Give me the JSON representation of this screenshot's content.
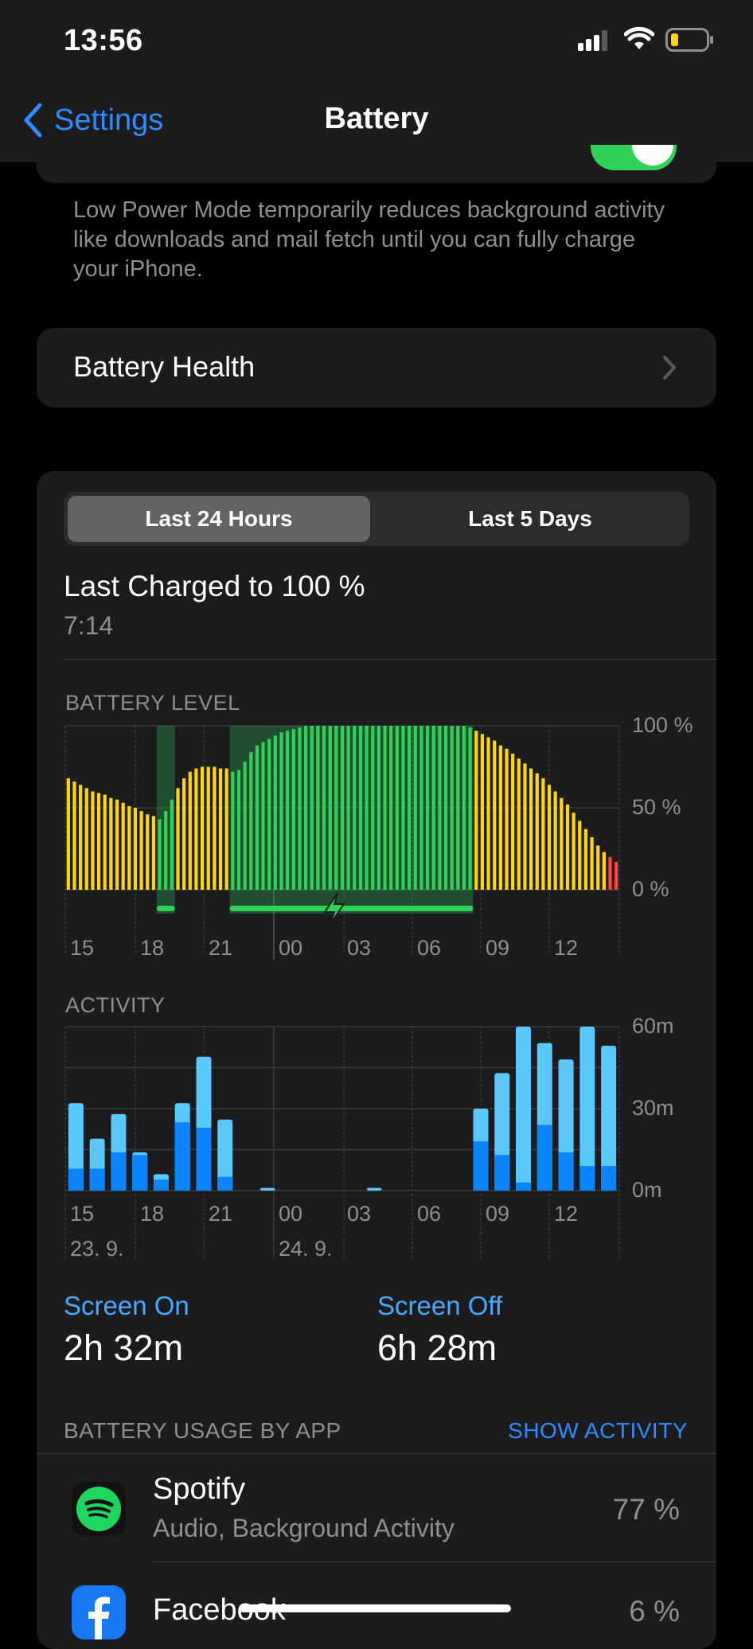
{
  "status": {
    "time": "13:56"
  },
  "nav": {
    "back_label": "Settings",
    "title": "Battery"
  },
  "low_power": {
    "description": "Low Power Mode temporarily reduces background activity like downloads and mail fetch until you can fully charge your iPhone.",
    "toggle_on": true
  },
  "battery_health": {
    "label": "Battery Health"
  },
  "segments": {
    "options": [
      "Last 24 Hours",
      "Last 5 Days"
    ],
    "selected": "Last 24 Hours"
  },
  "last_charged": {
    "title": "Last Charged to 100 %",
    "time": "7:14"
  },
  "battery_level": {
    "label": "BATTERY LEVEL",
    "y_ticks": [
      "100 %",
      "50 %",
      "0 %"
    ],
    "x_ticks": [
      "15",
      "18",
      "21",
      "00",
      "03",
      "06",
      "09",
      "12"
    ]
  },
  "activity": {
    "label": "ACTIVITY",
    "y_ticks": [
      "60m",
      "30m",
      "0m"
    ],
    "x_ticks": [
      "15",
      "18",
      "21",
      "00",
      "03",
      "06",
      "09",
      "12"
    ],
    "date_labels": [
      "23. 9.",
      "24. 9."
    ]
  },
  "screen_on": {
    "label": "Screen On",
    "value": "2h 32m"
  },
  "screen_off": {
    "label": "Screen Off",
    "value": "6h 28m"
  },
  "usage": {
    "label": "BATTERY USAGE BY APP",
    "show_activity": "SHOW ACTIVITY",
    "apps": [
      {
        "name": "Spotify",
        "detail": "Audio, Background Activity",
        "percent": "77 %",
        "icon": "spotify-icon"
      },
      {
        "name": "Facebook",
        "detail": "",
        "percent": "6 %",
        "icon": "facebook-icon"
      }
    ]
  },
  "chart_data": [
    {
      "type": "bar",
      "title": "BATTERY LEVEL",
      "x_ticks": [
        "15",
        "18",
        "21",
        "00",
        "03",
        "06",
        "09",
        "12"
      ],
      "ylim": [
        0,
        100
      ],
      "y_ticks": [
        "0 %",
        "50 %",
        "100 %"
      ],
      "unit": "%",
      "values": [
        68,
        66,
        64,
        62,
        60,
        59,
        58,
        56,
        55,
        53,
        51,
        50,
        48,
        46,
        45,
        43,
        48,
        55,
        62,
        68,
        72,
        74,
        75,
        75,
        75,
        74,
        74,
        72,
        73,
        78,
        84,
        88,
        90,
        92,
        94,
        96,
        97,
        98,
        99,
        100,
        100,
        100,
        100,
        100,
        100,
        100,
        100,
        100,
        100,
        100,
        100,
        100,
        100,
        100,
        100,
        100,
        100,
        100,
        100,
        100,
        100,
        100,
        100,
        100,
        100,
        100,
        99,
        97,
        95,
        93,
        91,
        88,
        86,
        83,
        80,
        77,
        74,
        71,
        68,
        64,
        60,
        56,
        52,
        47,
        42,
        37,
        32,
        27,
        23,
        20,
        17
      ],
      "colors_by_state": {
        "charging": "#30d158",
        "normal": "#ffd60a",
        "low": "#ff453a"
      },
      "charging_ranges": [
        [
          15,
          17
        ],
        [
          27,
          66
        ]
      ]
    },
    {
      "type": "bar",
      "title": "ACTIVITY",
      "x_ticks": [
        "15",
        "18",
        "21",
        "00",
        "03",
        "06",
        "09",
        "12"
      ],
      "ylim": [
        0,
        60
      ],
      "y_ticks": [
        "0m",
        "30m",
        "60m"
      ],
      "series": [
        {
          "name": "Screen On",
          "values": [
            8,
            8,
            14,
            13,
            4,
            25,
            23,
            5,
            0,
            0,
            0,
            0,
            0,
            0,
            0,
            0,
            0,
            0,
            0,
            18,
            13,
            3,
            24,
            14,
            9,
            9
          ]
        },
        {
          "name": "Screen Off",
          "values": [
            24,
            11,
            14,
            1,
            2,
            7,
            26,
            21,
            0,
            1,
            0,
            0,
            0,
            0,
            1,
            0,
            0,
            0,
            0,
            12,
            30,
            57,
            30,
            34,
            51,
            44
          ]
        }
      ],
      "colors": {
        "Screen On": "#0a84ff",
        "Screen Off": "#5ac8fa"
      },
      "date_labels": [
        "23. 9.",
        "24. 9."
      ]
    }
  ]
}
